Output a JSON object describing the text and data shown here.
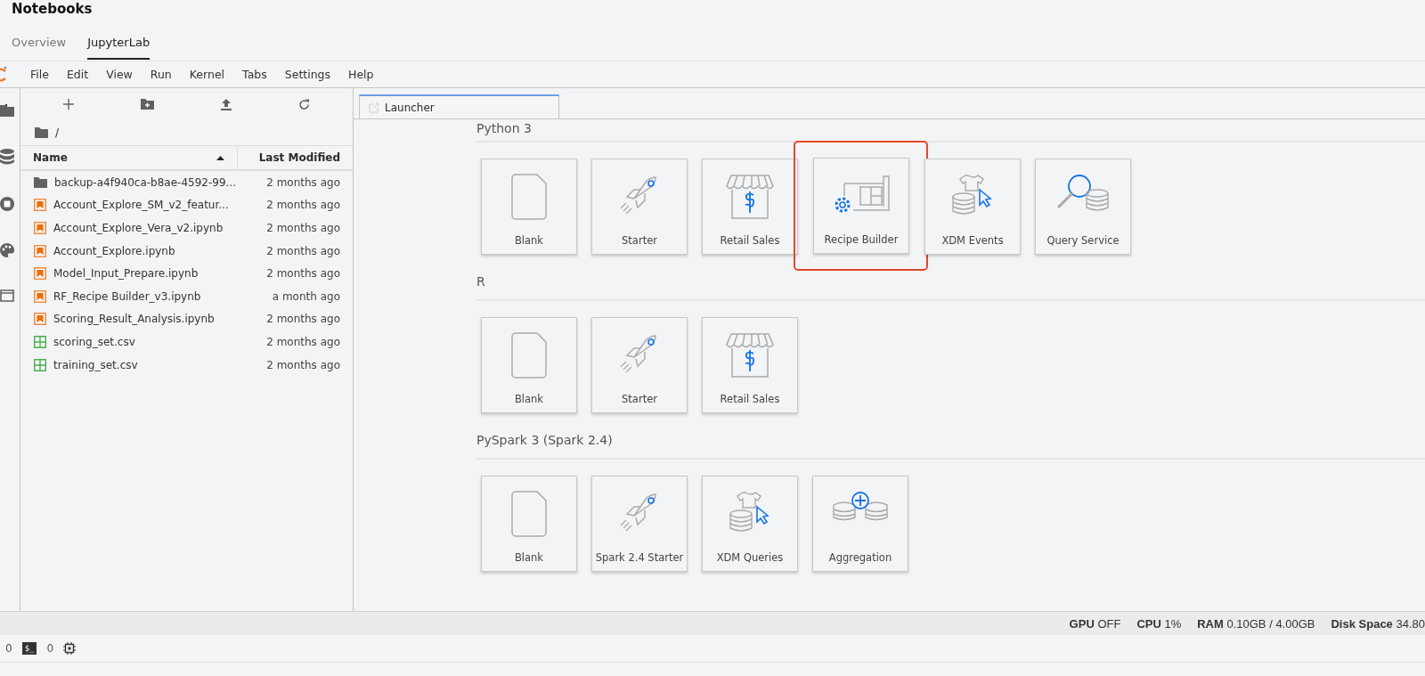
{
  "header": {
    "title": "Notebooks"
  },
  "tabs": [
    {
      "label": "Overview",
      "selected": false
    },
    {
      "label": "JupyterLab",
      "selected": true
    }
  ],
  "menu": [
    "File",
    "Edit",
    "View",
    "Run",
    "Kernel",
    "Tabs",
    "Settings",
    "Help"
  ],
  "side_icons": [
    {
      "kind": "folder",
      "selected": true
    },
    {
      "kind": "database",
      "selected": false
    },
    {
      "kind": "stop",
      "selected": false
    },
    {
      "kind": "palette",
      "selected": false
    },
    {
      "kind": "tabs",
      "selected": false
    }
  ],
  "file_browser": {
    "path": "/",
    "columns": [
      {
        "label": "Name",
        "sorted": true
      },
      {
        "label": "Last Modified",
        "sorted": false
      }
    ],
    "files": [
      {
        "kind": "folder",
        "name": "backup-a4f940ca-b8ae-4592-99...",
        "modified": "2 months ago"
      },
      {
        "kind": "notebook",
        "name": "Account_Explore_SM_v2_featur...",
        "modified": "2 months ago"
      },
      {
        "kind": "notebook",
        "name": "Account_Explore_Vera_v2.ipynb",
        "modified": "2 months ago"
      },
      {
        "kind": "notebook",
        "name": "Account_Explore.ipynb",
        "modified": "2 months ago"
      },
      {
        "kind": "notebook",
        "name": "Model_Input_Prepare.ipynb",
        "modified": "2 months ago"
      },
      {
        "kind": "notebook",
        "name": "RF_Recipe Builder_v3.ipynb",
        "modified": "a month ago"
      },
      {
        "kind": "notebook",
        "name": "Scoring_Result_Analysis.ipynb",
        "modified": "2 months ago"
      },
      {
        "kind": "csv",
        "name": "scoring_set.csv",
        "modified": "2 months ago"
      },
      {
        "kind": "csv",
        "name": "training_set.csv",
        "modified": "2 months ago"
      }
    ]
  },
  "launcher": {
    "tab": "Launcher",
    "sections": [
      {
        "title": "Python 3",
        "cards": [
          {
            "kind": "blank",
            "label": "Blank",
            "highlighted": false
          },
          {
            "kind": "rocket",
            "label": "Starter",
            "highlighted": false
          },
          {
            "kind": "store",
            "label": "Retail Sales",
            "highlighted": false
          },
          {
            "kind": "recipe",
            "label": "Recipe Builder",
            "highlighted": true
          },
          {
            "kind": "xdm",
            "label": "XDM Events",
            "highlighted": false
          },
          {
            "kind": "query",
            "label": "Query Service",
            "highlighted": false
          }
        ]
      },
      {
        "title": "R",
        "cards": [
          {
            "kind": "blank",
            "label": "Blank",
            "highlighted": false
          },
          {
            "kind": "rocket",
            "label": "Starter",
            "highlighted": false
          },
          {
            "kind": "store",
            "label": "Retail Sales",
            "highlighted": false
          }
        ]
      },
      {
        "title": "PySpark 3 (Spark 2.4)",
        "cards": [
          {
            "kind": "blank",
            "label": "Blank",
            "highlighted": false
          },
          {
            "kind": "rocket",
            "label": "Spark 2.4 Starter",
            "highlighted": false
          },
          {
            "kind": "xdm",
            "label": "XDM Queries",
            "highlighted": false
          },
          {
            "kind": "aggregation",
            "label": "Aggregation",
            "highlighted": false
          }
        ]
      }
    ]
  },
  "resources": [
    {
      "label": "GPU",
      "value": "OFF"
    },
    {
      "label": "CPU",
      "value": "1%"
    },
    {
      "label": "RAM",
      "value": "0.10GB / 4.00GB"
    },
    {
      "label": "Disk Space",
      "value": "34.80"
    }
  ],
  "status_bar": {
    "kernels": "0",
    "terminal": "$_",
    "terminals": "0"
  }
}
